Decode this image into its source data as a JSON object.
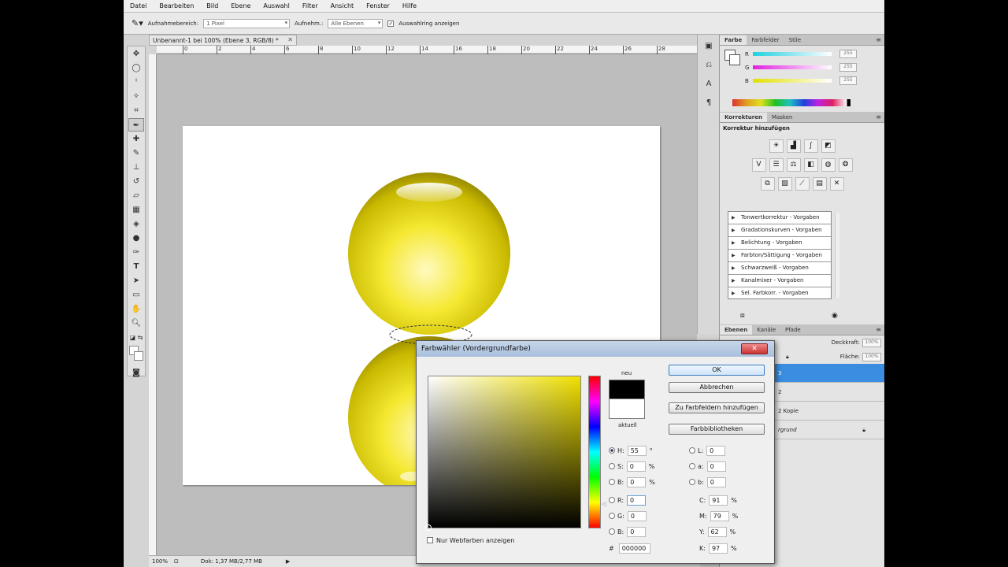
{
  "menu": [
    "Datei",
    "Bearbeiten",
    "Bild",
    "Ebene",
    "Auswahl",
    "Filter",
    "Ansicht",
    "Fenster",
    "Hilfe"
  ],
  "options": {
    "sample_label": "Aufnahmebereich:",
    "sample_value": "1 Pixel",
    "take_label": "Aufnehm.:",
    "take_value": "Alle Ebenen",
    "ring_label": "Auswahlring anzeigen"
  },
  "document": {
    "tab_title": "Unbenannt-1 bei 100% (Ebene 3, RGB/8) *",
    "ruler_marks": [
      "0",
      "2",
      "4",
      "6",
      "8",
      "10",
      "12",
      "14",
      "16",
      "18",
      "20",
      "22",
      "24",
      "26",
      "28"
    ]
  },
  "status": {
    "zoom": "100%",
    "doc_size": "Dok: 1,37 MB/2,77 MB"
  },
  "color_panel": {
    "tabs": [
      "Farbe",
      "Farbfelder",
      "Stile"
    ],
    "channels": [
      {
        "name": "R",
        "value": "255",
        "color": "#28d8e8"
      },
      {
        "name": "G",
        "value": "255",
        "color": "#e030e0"
      },
      {
        "name": "B",
        "value": "255",
        "color": "#e8e020"
      }
    ]
  },
  "adjustments_panel": {
    "tabs": [
      "Korrekturen",
      "Masken"
    ],
    "header": "Korrektur hinzufügen",
    "presets": [
      "Tonwertkorrektur - Vorgaben",
      "Gradationskurven - Vorgaben",
      "Belichtung - Vorgaben",
      "Farbton/Sättigung - Vorgaben",
      "Schwarzweiß - Vorgaben",
      "Kanalmixer - Vorgaben",
      "Sel. Farbkorr. - Vorgaben"
    ]
  },
  "layers_panel": {
    "tabs": [
      "Ebenen",
      "Kanäle",
      "Pfade"
    ],
    "opacity_label": "Deckkraft:",
    "opacity_value": "100%",
    "fill_label": "Fläche:",
    "fill_value": "100%",
    "rows": [
      "3",
      "2",
      "2 Kopie",
      "rgrund"
    ]
  },
  "color_picker": {
    "title": "Farbwähler (Vordergrundfarbe)",
    "new_label": "neu",
    "current_label": "aktuell",
    "buttons": {
      "ok": "OK",
      "cancel": "Abbrechen",
      "add_swatch": "Zu Farbfeldern hinzufügen",
      "libraries": "Farbbibliotheken"
    },
    "fields": {
      "H": {
        "value": "55",
        "unit": "°"
      },
      "S": {
        "value": "0",
        "unit": "%"
      },
      "B": {
        "value": "0",
        "unit": "%"
      },
      "R": {
        "value": "0"
      },
      "G": {
        "value": "0"
      },
      "B2": {
        "value": "0"
      },
      "L": {
        "value": "0"
      },
      "a": {
        "value": "0"
      },
      "b": {
        "value": "0"
      },
      "C": {
        "value": "91",
        "unit": "%"
      },
      "M": {
        "value": "79",
        "unit": "%"
      },
      "Y": {
        "value": "62",
        "unit": "%"
      },
      "K": {
        "value": "97",
        "unit": "%"
      },
      "hex": "000000"
    },
    "web_only_label": "Nur Webfarben anzeigen",
    "new_color": "#000000",
    "current_color": "#ffffff"
  }
}
